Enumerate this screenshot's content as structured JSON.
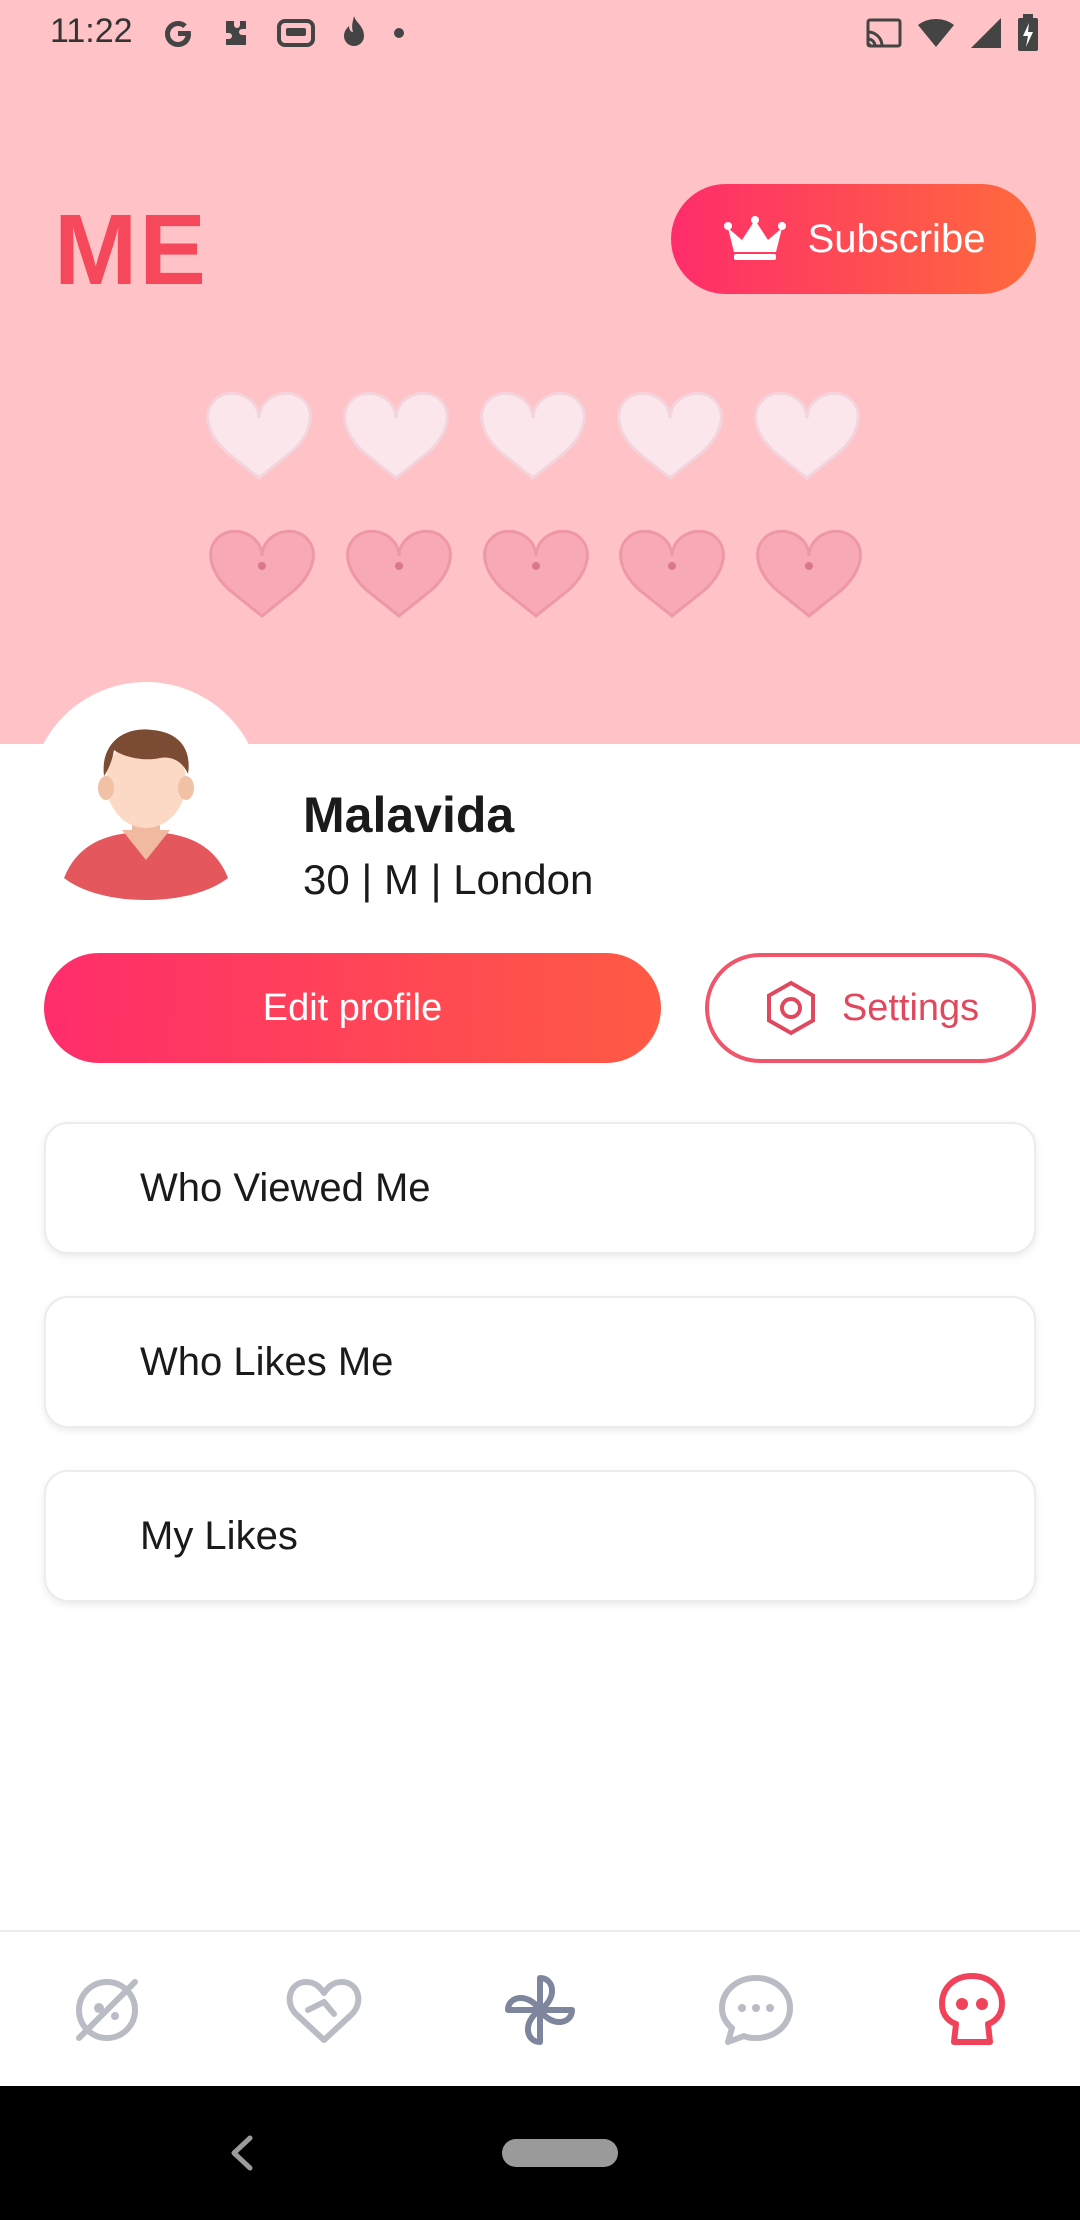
{
  "status_bar": {
    "time": "11:22"
  },
  "header": {
    "title": "ME",
    "subscribe_label": "Subscribe"
  },
  "profile": {
    "name": "Malavida",
    "info": "30 | M | London"
  },
  "actions": {
    "edit_profile_label": "Edit profile",
    "settings_label": "Settings"
  },
  "menu": {
    "items": [
      {
        "label": "Who Viewed Me"
      },
      {
        "label": "Who Likes Me"
      },
      {
        "label": "My Likes"
      }
    ]
  },
  "bottom_nav": {
    "items": [
      {
        "icon": "discover-icon",
        "active": false
      },
      {
        "icon": "heart-icon",
        "active": false
      },
      {
        "icon": "pinwheel-icon",
        "active": false
      },
      {
        "icon": "chat-icon",
        "active": false
      },
      {
        "icon": "profile-icon",
        "active": true
      }
    ]
  },
  "colors": {
    "banner_bg": "#ffc3c7",
    "accent_start": "#ff2d6b",
    "accent_end": "#ff6a3d",
    "title": "#f5485a",
    "inactive_icon": "#b9bcc4",
    "active_icon": "#f0435b"
  }
}
